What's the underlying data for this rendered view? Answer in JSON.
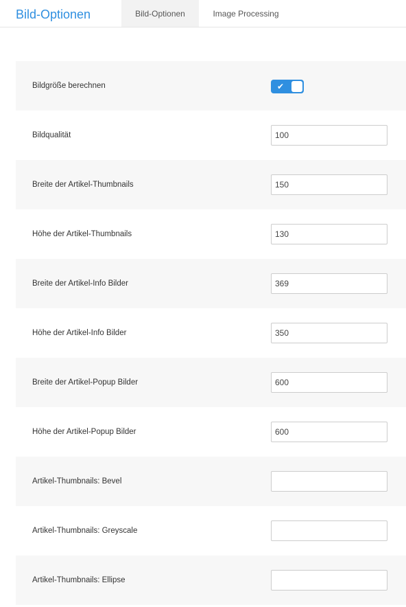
{
  "header": {
    "title": "Bild-Optionen",
    "tabs": [
      {
        "label": "Bild-Optionen",
        "active": true
      },
      {
        "label": "Image Processing",
        "active": false
      }
    ]
  },
  "colors": {
    "accent": "#2f8fe0",
    "row_shade": "#f7f7f7"
  },
  "settings": [
    {
      "label": "Bildgröße berechnen",
      "type": "toggle",
      "value": "on",
      "icon": "check-icon"
    },
    {
      "label": "Bildqualität",
      "type": "text",
      "value": "100"
    },
    {
      "label": "Breite der Artikel-Thumbnails",
      "type": "text",
      "value": "150"
    },
    {
      "label": "Höhe der Artikel-Thumbnails",
      "type": "text",
      "value": "130"
    },
    {
      "label": "Breite der Artikel-Info Bilder",
      "type": "text",
      "value": "369"
    },
    {
      "label": "Höhe der Artikel-Info Bilder",
      "type": "text",
      "value": "350"
    },
    {
      "label": "Breite der Artikel-Popup Bilder",
      "type": "text",
      "value": "600"
    },
    {
      "label": "Höhe der Artikel-Popup Bilder",
      "type": "text",
      "value": "600"
    },
    {
      "label": "Artikel-Thumbnails: Bevel",
      "type": "text",
      "value": ""
    },
    {
      "label": "Artikel-Thumbnails: Greyscale",
      "type": "text",
      "value": ""
    },
    {
      "label": "Artikel-Thumbnails: Ellipse",
      "type": "text",
      "value": ""
    }
  ]
}
